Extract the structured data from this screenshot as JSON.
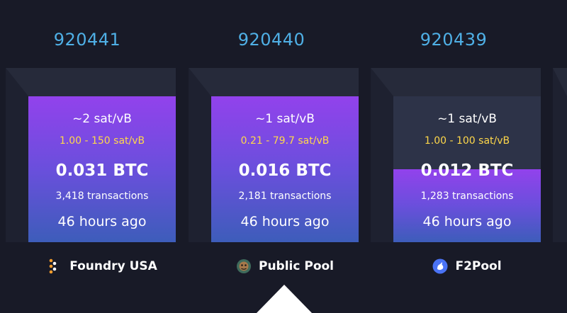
{
  "blocks": [
    {
      "height": "920441",
      "median_fee": "~2 sat/vB",
      "fee_range": "1.00 - 150 sat/vB",
      "reward": "0.031 BTC",
      "transactions": "3,418 transactions",
      "time": "46 hours ago",
      "pool": "Foundry USA",
      "pool_icon": "foundry-usa-logo",
      "fullness": 1.0
    },
    {
      "height": "920440",
      "median_fee": "~1 sat/vB",
      "fee_range": "0.21 - 79.7 sat/vB",
      "reward": "0.016 BTC",
      "transactions": "2,181 transactions",
      "time": "46 hours ago",
      "pool": "Public Pool",
      "pool_icon": "public-pool-logo",
      "fullness": 1.0
    },
    {
      "height": "920439",
      "median_fee": "~1 sat/vB",
      "fee_range": "1.00 - 100 sat/vB",
      "reward": "0.012 BTC",
      "transactions": "1,283 transactions",
      "time": "46 hours ago",
      "pool": "F2Pool",
      "pool_icon": "f2pool-logo",
      "fullness": 0.5
    }
  ],
  "colors": {
    "background": "#181a27",
    "height_link": "#4fb0e6",
    "fee_range": "#ffd84a",
    "fill_top": "#9242ec",
    "fill_bottom": "#3d5dba",
    "empty_face": "#2d3348"
  }
}
